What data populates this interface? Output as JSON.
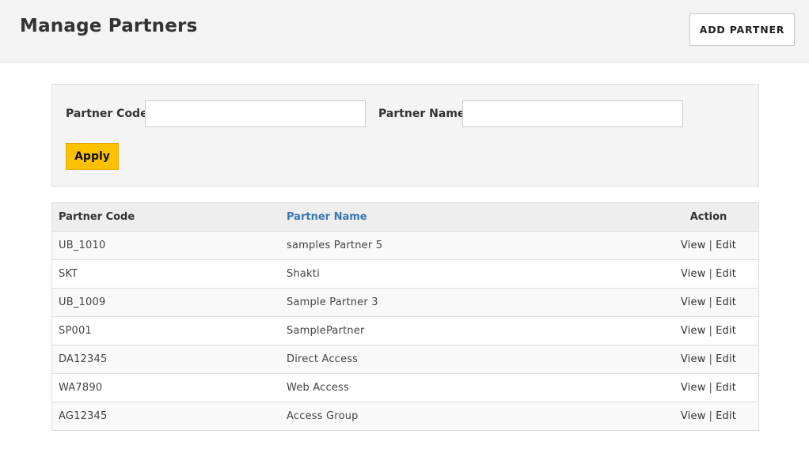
{
  "header": {
    "title": "Manage Partners",
    "add_button": "ADD PARTNER"
  },
  "filters": {
    "code_label": "Partner Code",
    "code_value": "",
    "name_label": "Partner Name",
    "name_value": "",
    "apply_label": "Apply"
  },
  "table": {
    "headers": {
      "code": "Partner Code",
      "name": "Partner Name",
      "action": "Action"
    },
    "view_label": "View",
    "separator": "|",
    "edit_label": "Edit",
    "rows": [
      {
        "code": "UB_1010",
        "name": "samples Partner 5"
      },
      {
        "code": "SKT",
        "name": "Shakti"
      },
      {
        "code": "UB_1009",
        "name": "Sample Partner 3"
      },
      {
        "code": "SP001",
        "name": "SamplePartner"
      },
      {
        "code": "DA12345",
        "name": "Direct Access"
      },
      {
        "code": "WA7890",
        "name": "Web Access"
      },
      {
        "code": "AG12345",
        "name": "Access Group"
      }
    ]
  },
  "colors": {
    "apply_button": "#fcc200",
    "sortable_header_link": "#3a78b5",
    "header_bg": "#f3f3f3"
  }
}
